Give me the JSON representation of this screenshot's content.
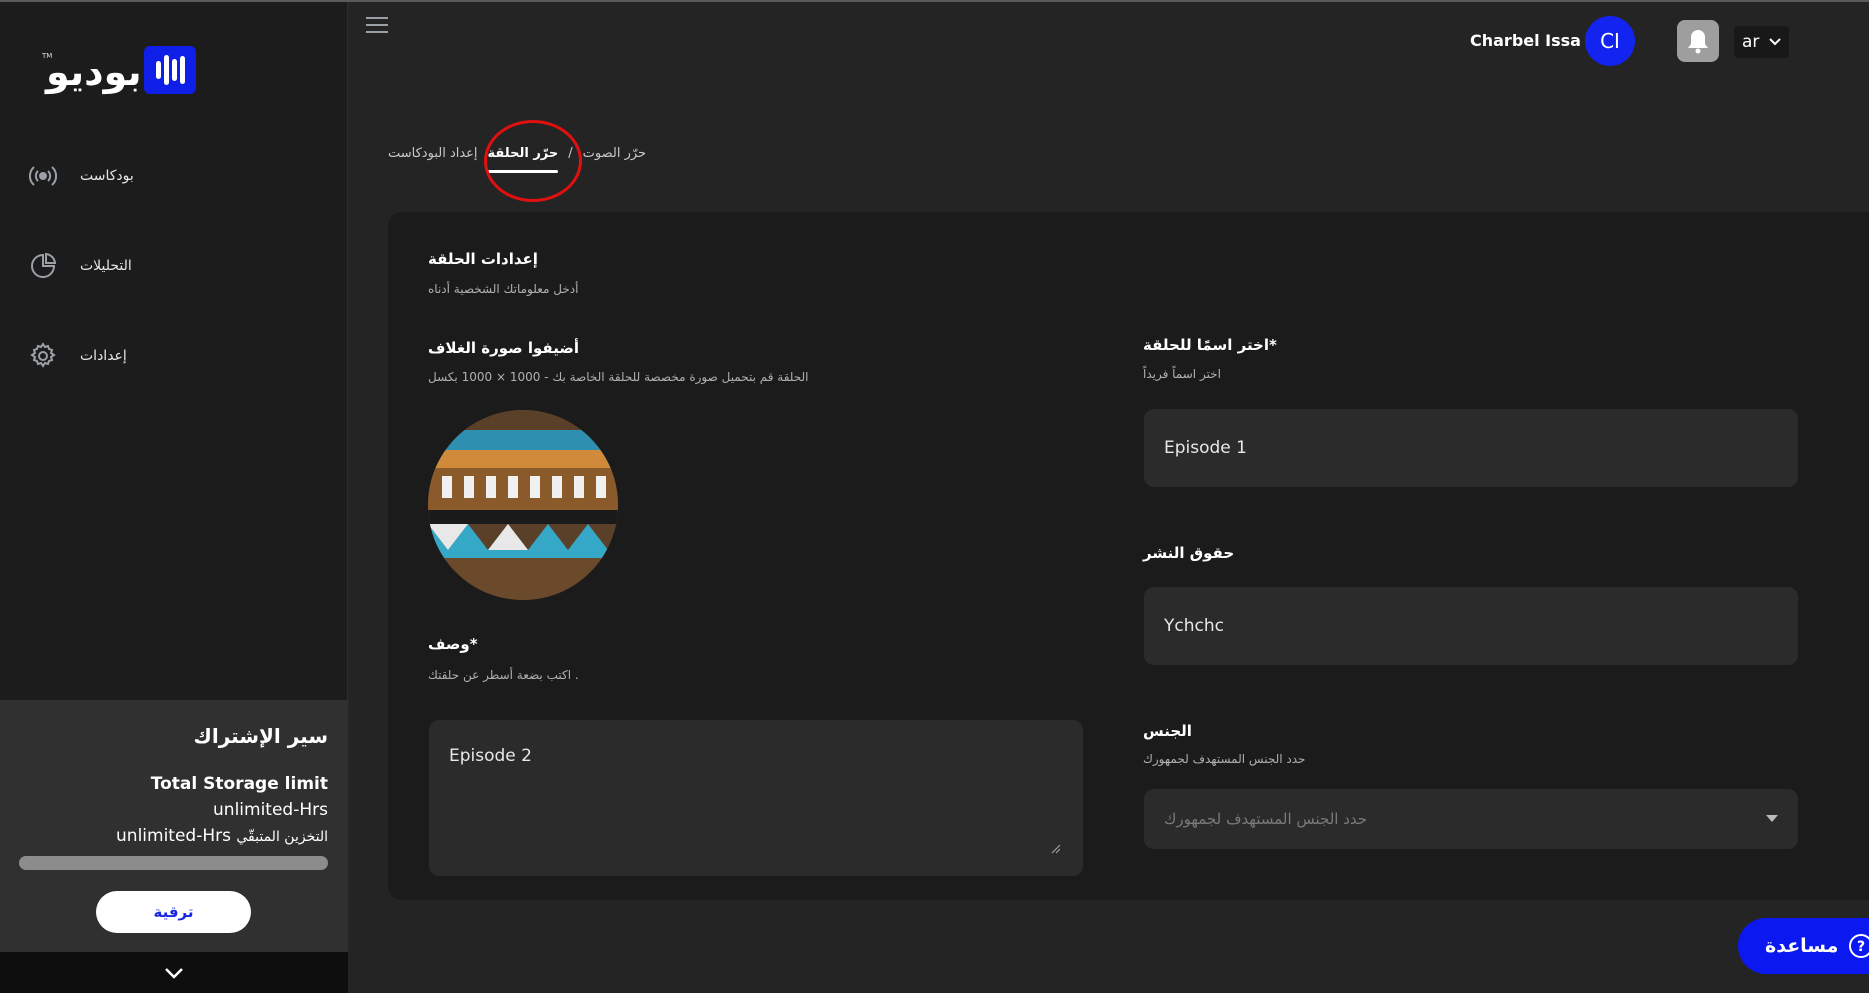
{
  "brand": {
    "logo_text": "بوديو",
    "logo_tm": "TM",
    "accent": "#1424f0"
  },
  "sidebar": {
    "items": [
      {
        "label": "بودكاست",
        "icon": "podcast-broadcast-icon"
      },
      {
        "label": "التحليلات",
        "icon": "analytics-pie-icon"
      },
      {
        "label": "إعدادات",
        "icon": "settings-gear-icon"
      }
    ],
    "subscription": {
      "title": "سير الإشتراك",
      "storage_label": "Total Storage limit",
      "storage_value": "unlimited-Hrs",
      "remaining_value": "unlimited-Hrs",
      "remaining_label": "التخزين المتبقّي",
      "upgrade_label": "ترقية"
    }
  },
  "header": {
    "user_name": "Charbel Issa",
    "avatar_initials": "CI",
    "language": "ar"
  },
  "breadcrumb": {
    "items": [
      "إعداد البودكاست",
      "حرّر الحلقة",
      "حرّر الصوت"
    ],
    "separator": "/",
    "active_index": 1
  },
  "form": {
    "section_title": "إعدادات الحلقة",
    "section_subtitle": "أدخل معلوماتك الشخصية أدناه",
    "cover": {
      "title": "أضيفوا صورة الغلاف",
      "subtitle": "الحلقة قم بتحميل صورة مخصصة للحلقة الخاصة بك - 1000 × 1000 بكسل"
    },
    "description": {
      "title": "وصف*",
      "subtitle": "اكتب بضعة أسطر عن حلقتك .",
      "value": "Episode 2"
    },
    "episode_name": {
      "title": "اختر اسمًا للحلقة*",
      "subtitle": "اختر اسماً فريداً",
      "value": "Episode 1"
    },
    "copyright": {
      "title": "حقوق النشر",
      "value": "Ychchc"
    },
    "gender": {
      "title": "الجنس",
      "subtitle": "حدد الجنس المستهدف لجمهورك",
      "placeholder": "حدد الجنس المستهدف لجمهورك"
    }
  },
  "help": {
    "label": "مساعدة"
  }
}
